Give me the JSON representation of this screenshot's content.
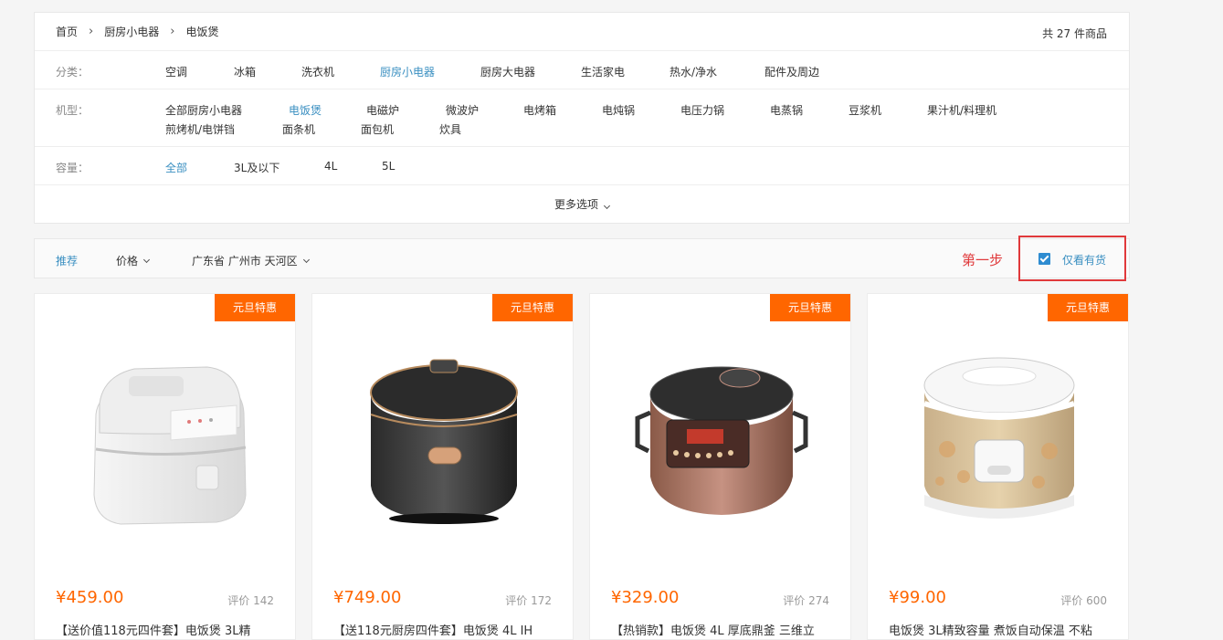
{
  "breadcrumb": [
    "首页",
    "厨房小电器",
    "电饭煲"
  ],
  "total": "共 27 件商品",
  "filters": {
    "category": {
      "label": "分类：",
      "options": [
        "空调",
        "冰箱",
        "洗衣机",
        "厨房小电器",
        "厨房大电器",
        "生活家电",
        "热水/净水",
        "配件及周边"
      ],
      "active": "厨房小电器"
    },
    "model": {
      "label": "机型：",
      "options": [
        "全部厨房小电器",
        "电饭煲",
        "电磁炉",
        "微波炉",
        "电烤箱",
        "电炖锅",
        "电压力锅",
        "电蒸锅",
        "豆浆机",
        "果汁机/料理机",
        "煎烤机/电饼铛",
        "面条机",
        "面包机",
        "炊具"
      ],
      "active": "电饭煲"
    },
    "capacity": {
      "label": "容量：",
      "options": [
        "全部",
        "3L及以下",
        "4L",
        "5L"
      ],
      "active": "全部"
    }
  },
  "more_options": "更多选项",
  "sort": {
    "recommend": "推荐",
    "price": "价格",
    "location": "广东省 广州市 天河区"
  },
  "step_label": "第一步",
  "stock_only": {
    "label": "仅看有货",
    "checked": true
  },
  "products": [
    {
      "badge": "元旦特惠",
      "price": "¥459.00",
      "rating": "评价 142",
      "title": "【送价值118元四件套】电饭煲 3L精",
      "image": "white-square-rice-cooker"
    },
    {
      "badge": "元旦特惠",
      "price": "¥749.00",
      "rating": "评价 172",
      "title": "【送118元厨房四件套】电饭煲 4L IH",
      "image": "black-round-rice-cooker"
    },
    {
      "badge": "元旦特惠",
      "price": "¥329.00",
      "rating": "评价 274",
      "title": "【热销款】电饭煲 4L 厚底鼎釜 三维立",
      "image": "bronze-rice-cooker"
    },
    {
      "badge": "元旦特惠",
      "price": "¥99.00",
      "rating": "评价 600",
      "title": "电饭煲 3L精致容量 煮饭自动保温 不粘",
      "image": "floral-classic-rice-cooker"
    }
  ],
  "colors": {
    "accent": "#3a8fc1",
    "price": "#ff6600",
    "badge": "#ff6600",
    "highlight": "#e0393b"
  }
}
